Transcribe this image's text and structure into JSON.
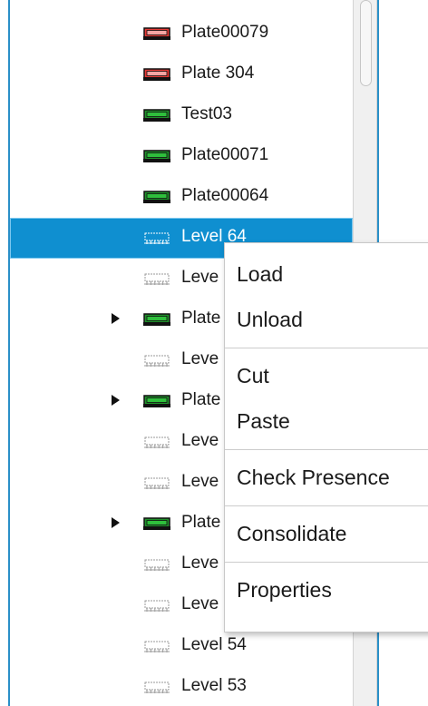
{
  "tree": {
    "items": [
      {
        "label": "Plate00079",
        "icon": "plate-icon-red",
        "color": "#e53935",
        "expander": false,
        "selected": false
      },
      {
        "label": "Plate 304",
        "icon": "plate-icon-red",
        "color": "#e53935",
        "expander": false,
        "selected": false
      },
      {
        "label": "Test03",
        "icon": "plate-icon-green",
        "color": "#1f8f2a",
        "expander": false,
        "selected": false
      },
      {
        "label": "Plate00071",
        "icon": "plate-icon-green",
        "color": "#1f8f2a",
        "expander": false,
        "selected": false
      },
      {
        "label": "Plate00064",
        "icon": "plate-icon-green",
        "color": "#1f8f2a",
        "expander": false,
        "selected": false
      },
      {
        "label": "Level 64",
        "icon": "level-icon",
        "color": "#888888",
        "expander": false,
        "selected": true
      },
      {
        "label": "Leve",
        "icon": "level-icon",
        "color": "#888888",
        "expander": false,
        "selected": false
      },
      {
        "label": "Plate",
        "icon": "plate-icon-green",
        "color": "#1f8f2a",
        "expander": true,
        "selected": false
      },
      {
        "label": "Leve",
        "icon": "level-icon",
        "color": "#888888",
        "expander": false,
        "selected": false
      },
      {
        "label": "Plate",
        "icon": "plate-icon-green",
        "color": "#1f8f2a",
        "expander": true,
        "selected": false
      },
      {
        "label": "Leve",
        "icon": "level-icon",
        "color": "#888888",
        "expander": false,
        "selected": false
      },
      {
        "label": "Leve",
        "icon": "level-icon",
        "color": "#888888",
        "expander": false,
        "selected": false
      },
      {
        "label": "Plate",
        "icon": "plate-icon-green",
        "color": "#1f8f2a",
        "expander": true,
        "selected": false
      },
      {
        "label": "Leve",
        "icon": "level-icon",
        "color": "#888888",
        "expander": false,
        "selected": false
      },
      {
        "label": "Leve",
        "icon": "level-icon",
        "color": "#888888",
        "expander": false,
        "selected": false
      },
      {
        "label": "Level 54",
        "icon": "level-icon",
        "color": "#888888",
        "expander": false,
        "selected": false
      },
      {
        "label": "Level 53",
        "icon": "level-icon",
        "color": "#888888",
        "expander": false,
        "selected": false
      }
    ]
  },
  "context_menu": {
    "groups": [
      [
        "Load",
        "Unload"
      ],
      [
        "Cut",
        "Paste"
      ],
      [
        "Check Presence"
      ],
      [
        "Consolidate"
      ],
      [
        "Properties"
      ]
    ]
  },
  "colors": {
    "selection": "#0f8fd0",
    "panel_border": "#2a90c8"
  }
}
